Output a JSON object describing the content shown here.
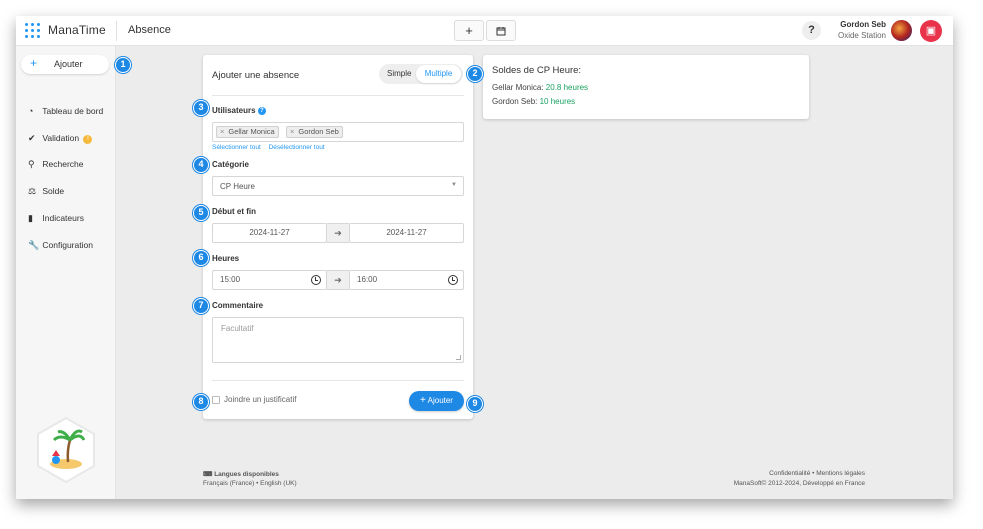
{
  "app": {
    "brand": "ManaTime",
    "page_title": "Absence"
  },
  "topbar": {
    "add_icon": "plus-icon",
    "calendar_icon": "calendar-icon",
    "help_label": "?",
    "user_name": "Gordon Seb",
    "user_org": "Oxide Station"
  },
  "sidebar": {
    "add_label": "Ajouter",
    "items": [
      {
        "label": "Tableau de bord",
        "icon": "pie-chart-icon"
      },
      {
        "label": "Validation",
        "icon": "check-icon",
        "badge": "!"
      },
      {
        "label": "Recherche",
        "icon": "search-icon"
      },
      {
        "label": "Solde",
        "icon": "scale-icon"
      },
      {
        "label": "Indicateurs",
        "icon": "bar-chart-icon"
      },
      {
        "label": "Configuration",
        "icon": "wrench-icon"
      }
    ]
  },
  "form": {
    "title": "Ajouter une absence",
    "mode_simple": "Simple",
    "mode_multiple": "Multiple",
    "users_label": "Utilisateurs",
    "users": [
      "Gellar Monica",
      "Gordon Seb"
    ],
    "select_all": "Sélectionner tout",
    "deselect_all": "Désélectionner tout",
    "category_label": "Catégorie",
    "category_value": "CP Heure",
    "dates_label": "Début et fin",
    "date_start": "2024-11-27",
    "date_end": "2024-11-27",
    "hours_label": "Heures",
    "hour_start": "15:00",
    "hour_end": "16:00",
    "comment_label": "Commentaire",
    "comment_placeholder": "Facultatif",
    "attach_label": "Joindre un justificatif",
    "submit_label": "Ajouter"
  },
  "balance": {
    "title": "Soldes de CP Heure:",
    "rows": [
      {
        "name": "Gellar Monica: ",
        "value": "20.8 heures"
      },
      {
        "name": "Gordon Seb: ",
        "value": "10 heures"
      }
    ]
  },
  "markers": [
    "1",
    "2",
    "3",
    "4",
    "5",
    "6",
    "7",
    "8",
    "9"
  ],
  "footer": {
    "languages_title": "Langues disponibles",
    "languages": "Français (France) • English (UK)",
    "legal": "Confidentialité • Mentions légales",
    "copyright": "ManaSoft© 2012-2024, Développé en France"
  },
  "colors": {
    "accent": "#1e88e5",
    "logout": "#e8334a",
    "balance_value": "#1aa260"
  }
}
